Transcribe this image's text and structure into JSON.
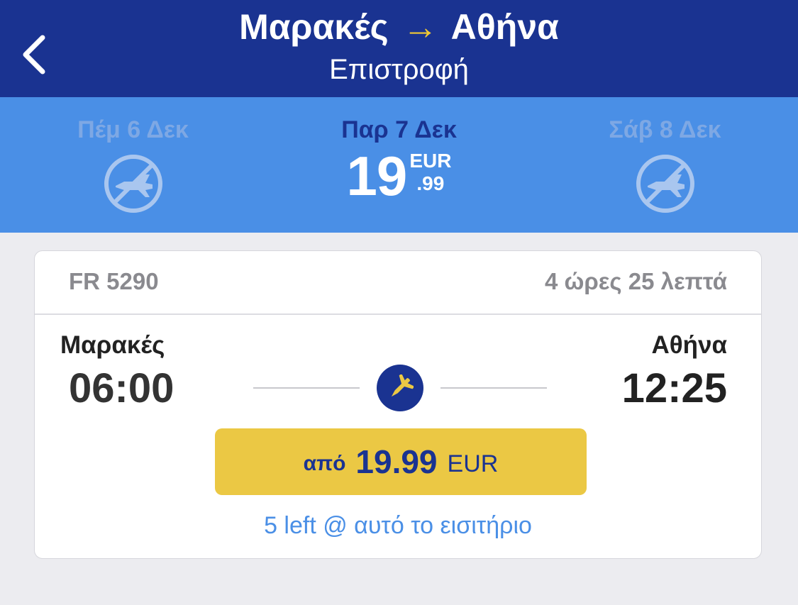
{
  "header": {
    "origin": "Μαρακές",
    "arrow": "→",
    "destination": "Αθήνα",
    "subtitle": "Επιστροφή"
  },
  "dates": [
    {
      "label": "Πέμ 6 Δεκ",
      "status": "no-flights",
      "icon": "no-flights-icon"
    },
    {
      "label": "Παρ 7 Δεκ",
      "status": "selected",
      "price_int": "19",
      "price_dec": ".99",
      "currency": "EUR"
    },
    {
      "label": "Σάβ 8 Δεκ",
      "status": "no-flights",
      "icon": "no-flights-icon"
    }
  ],
  "flight": {
    "number": "FR 5290",
    "duration": "4 ώρες 25 λεπτά",
    "origin_city": "Μαρακές",
    "departure_time": "06:00",
    "destination_city": "Αθήνα",
    "arrival_time": "12:25",
    "price_prefix": "από",
    "price_amount": "19.99",
    "price_currency": "EUR",
    "seats_left": "5 left @ αυτό το εισιτήριο"
  },
  "colors": {
    "header_bg": "#1a3391",
    "dates_bg": "#4a8fe6",
    "accent_yellow": "#ebc844",
    "arrow_yellow": "#f1c933"
  }
}
